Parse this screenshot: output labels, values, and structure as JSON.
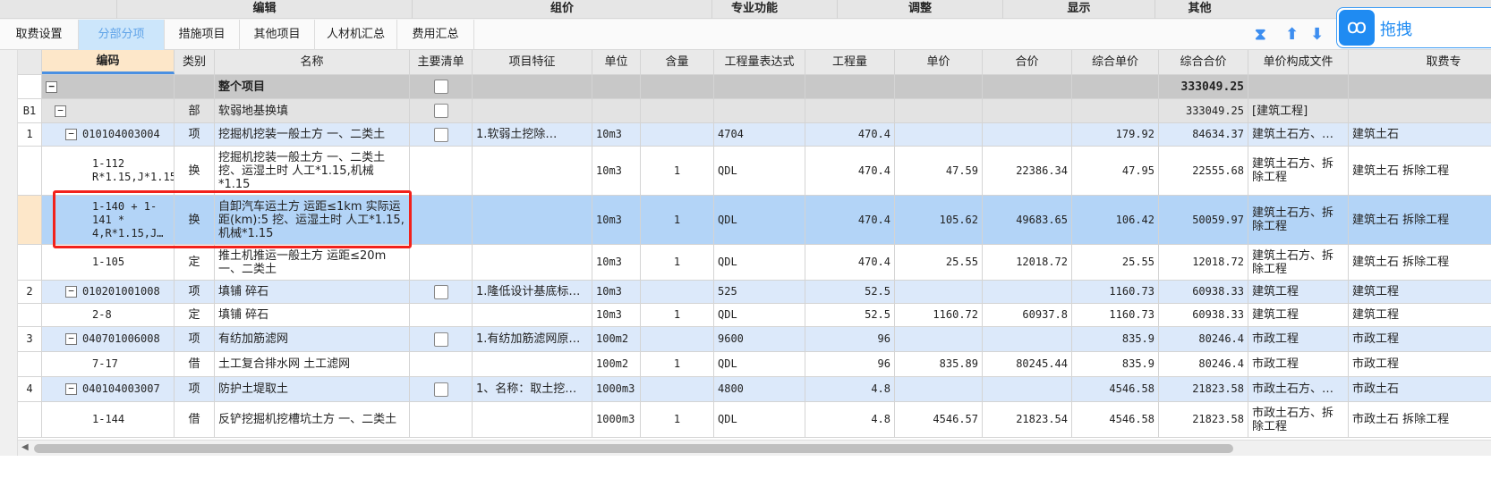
{
  "menubar": [
    "编辑",
    "组价",
    "专业功能",
    "调整",
    "显示",
    "其他"
  ],
  "tabs": [
    {
      "label": "取费设置",
      "active": false
    },
    {
      "label": "分部分项",
      "active": true
    },
    {
      "label": "措施项目",
      "active": false
    },
    {
      "label": "其他项目",
      "active": false
    },
    {
      "label": "人材机汇总",
      "active": false
    },
    {
      "label": "费用汇总",
      "active": false
    }
  ],
  "toolbar_icons": [
    "collapse-icon",
    "arrow-up-icon",
    "arrow-down-icon"
  ],
  "cloud_widget": {
    "icon": "cloud-icon",
    "label": "拖拽"
  },
  "accent_color": "#1f8bf2",
  "columns": [
    "",
    "编码",
    "类别",
    "名称",
    "主要清单",
    "项目特征",
    "单位",
    "含量",
    "工程量表达式",
    "工程量",
    "单价",
    "合价",
    "综合单价",
    "综合合价",
    "单价构成文件",
    "取费专"
  ],
  "rows": [
    {
      "kind": "total",
      "num": "",
      "code": "",
      "type": "",
      "name": "整个项目",
      "main": true,
      "feature": "",
      "unit": "",
      "content": "",
      "expr": "",
      "qty": "",
      "price": "",
      "sum": "",
      "cprice": "",
      "ctotal": "333049.25",
      "file": "",
      "fee": ""
    },
    {
      "kind": "section",
      "num": "B1",
      "code": "",
      "type": "部",
      "name": "软弱地基换填",
      "main": true,
      "feature": "",
      "unit": "",
      "content": "",
      "expr": "",
      "qty": "",
      "price": "",
      "sum": "",
      "cprice": "",
      "ctotal": "333049.25",
      "file": "[建筑工程]",
      "fee": ""
    },
    {
      "kind": "item",
      "num": "1",
      "code": "010104003004",
      "type": "项",
      "name": "挖掘机挖装一般土方 一、二类土",
      "main": true,
      "feature": "1.软弱土挖除…",
      "unit": "10m3",
      "content": "",
      "expr": "4704",
      "qty": "470.4",
      "price": "",
      "sum": "",
      "cprice": "179.92",
      "ctotal": "84634.37",
      "file": "建筑土石方、…",
      "fee": "建筑土石"
    },
    {
      "kind": "sub",
      "num": "",
      "code": "1-112 R*1.15,J*1.15",
      "type": "换",
      "name": "挖掘机挖装一般土方 一、二类土 挖、运湿土时 人工*1.15,机械*1.15",
      "main": false,
      "feature": "",
      "unit": "10m3",
      "content": "1",
      "expr": "QDL",
      "qty": "470.4",
      "price": "47.59",
      "sum": "22386.34",
      "cprice": "47.95",
      "ctotal": "22555.68",
      "file": "建筑土石方、拆除工程",
      "fee": "建筑土石 拆除工程"
    },
    {
      "kind": "selected",
      "num": "",
      "code": "1-140 + 1-141 * 4,R*1.15,J…",
      "type": "换",
      "name": "自卸汽车运土方 运距≤1km 实际运距(km):5 挖、运湿土时 人工*1.15,机械*1.15",
      "main": false,
      "feature": "",
      "unit": "10m3",
      "content": "1",
      "expr": "QDL",
      "qty": "470.4",
      "price": "105.62",
      "sum": "49683.65",
      "cprice": "106.42",
      "ctotal": "50059.97",
      "file": "建筑土石方、拆除工程",
      "fee": "建筑土石 拆除工程"
    },
    {
      "kind": "sub",
      "num": "",
      "code": "1-105",
      "type": "定",
      "name": "推土机推运一般土方 运距≤20m 一、二类土",
      "main": false,
      "feature": "",
      "unit": "10m3",
      "content": "1",
      "expr": "QDL",
      "qty": "470.4",
      "price": "25.55",
      "sum": "12018.72",
      "cprice": "25.55",
      "ctotal": "12018.72",
      "file": "建筑土石方、拆除工程",
      "fee": "建筑土石 拆除工程"
    },
    {
      "kind": "item",
      "num": "2",
      "code": "010201001008",
      "type": "项",
      "name": "填铺 碎石",
      "main": true,
      "feature": "1.隆低设计基底标…",
      "unit": "10m3",
      "content": "",
      "expr": "525",
      "qty": "52.5",
      "price": "",
      "sum": "",
      "cprice": "1160.73",
      "ctotal": "60938.33",
      "file": "建筑工程",
      "fee": "建筑工程"
    },
    {
      "kind": "sub",
      "num": "",
      "code": "2-8",
      "type": "定",
      "name": "填铺 碎石",
      "main": false,
      "feature": "",
      "unit": "10m3",
      "content": "1",
      "expr": "QDL",
      "qty": "52.5",
      "price": "1160.72",
      "sum": "60937.8",
      "cprice": "1160.73",
      "ctotal": "60938.33",
      "file": "建筑工程",
      "fee": "建筑工程"
    },
    {
      "kind": "item",
      "num": "3",
      "code": "040701006008",
      "type": "项",
      "name": "有纺加筋滤网",
      "main": true,
      "feature": "1.有纺加筋滤网原…",
      "unit": "100m2",
      "content": "",
      "expr": "9600",
      "qty": "96",
      "price": "",
      "sum": "",
      "cprice": "835.9",
      "ctotal": "80246.4",
      "file": "市政工程",
      "fee": "市政工程"
    },
    {
      "kind": "sub",
      "num": "",
      "code": "7-17",
      "type": "借",
      "name": "土工复合排水网 土工滤网",
      "main": false,
      "feature": "",
      "unit": "100m2",
      "content": "1",
      "expr": "QDL",
      "qty": "96",
      "price": "835.89",
      "sum": "80245.44",
      "cprice": "835.9",
      "ctotal": "80246.4",
      "file": "市政工程",
      "fee": "市政工程"
    },
    {
      "kind": "item",
      "num": "4",
      "code": "040104003007",
      "type": "项",
      "name": "防护土堤取土",
      "main": true,
      "feature": "1、名称：取土挖…",
      "unit": "1000m3",
      "content": "",
      "expr": "4800",
      "qty": "4.8",
      "price": "",
      "sum": "",
      "cprice": "4546.58",
      "ctotal": "21823.58",
      "file": "市政土石方、…",
      "fee": "市政土石"
    },
    {
      "kind": "sub",
      "num": "",
      "code": "1-144",
      "type": "借",
      "name": "反铲挖掘机挖槽坑土方 一、二类土",
      "main": false,
      "feature": "",
      "unit": "1000m3",
      "content": "1",
      "expr": "QDL",
      "qty": "4.8",
      "price": "4546.57",
      "sum": "21823.54",
      "cprice": "4546.58",
      "ctotal": "21823.58",
      "file": "市政土石方、拆除工程",
      "fee": "市政土石 拆除工程"
    }
  ]
}
